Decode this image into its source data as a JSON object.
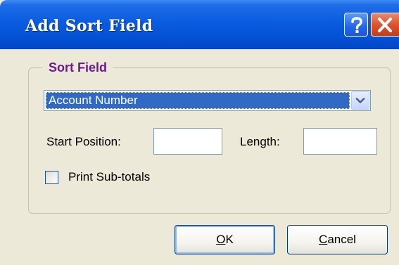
{
  "window": {
    "title": "Add Sort Field",
    "help_icon": "help-question-icon",
    "close_icon": "close-x-icon"
  },
  "group": {
    "legend": "Sort Field",
    "field_select": {
      "selected": "Account Number",
      "arrow_icon": "chevron-down-icon"
    },
    "start_position": {
      "label": "Start Position:",
      "value": ""
    },
    "length": {
      "label": "Length:",
      "value": ""
    },
    "print_subtotals": {
      "label": "Print Sub-totals",
      "checked": false
    }
  },
  "buttons": {
    "ok": {
      "mnemonic": "O",
      "rest": "K"
    },
    "cancel": {
      "mnemonic": "C",
      "rest": "ancel"
    }
  },
  "colors": {
    "titlebar": "#0a5ce0",
    "selection": "#316ac5",
    "legend_text": "#6c1a8f",
    "close_button": "#d9502b",
    "dialog_bg": "#ece9d8"
  }
}
